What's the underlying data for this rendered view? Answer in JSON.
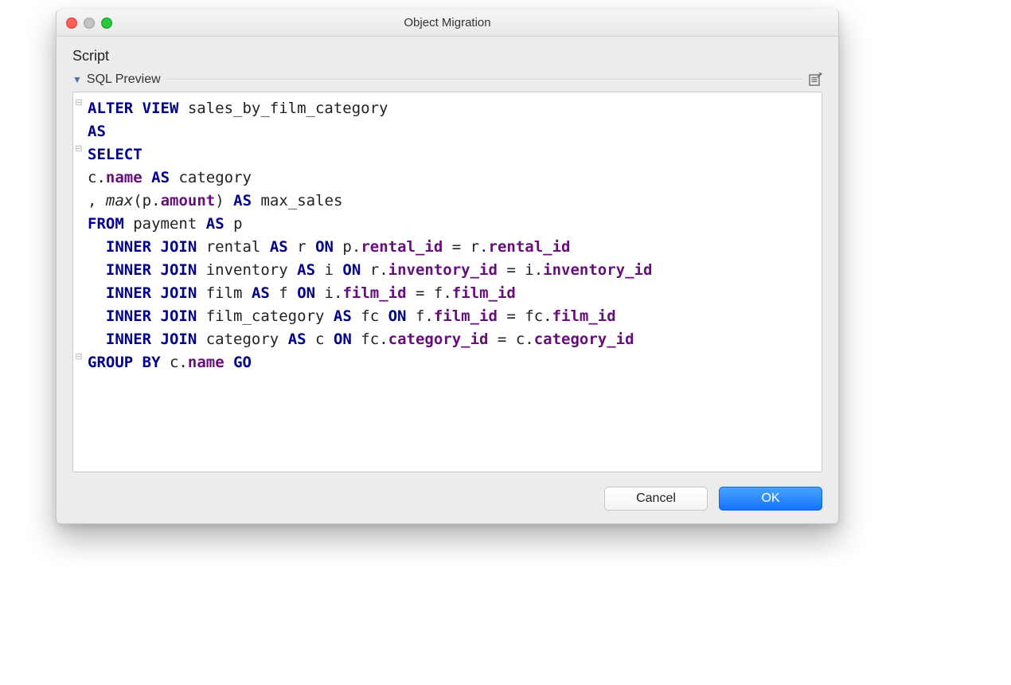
{
  "window": {
    "title": "Object Migration"
  },
  "section": {
    "label": "Script",
    "disclosure": "SQL Preview"
  },
  "code": {
    "l1": {
      "kw_alter_view": "ALTER VIEW",
      "view_name": "sales_by_film_category"
    },
    "l2": {
      "kw_as": "AS"
    },
    "l3": {
      "kw_select": "SELECT"
    },
    "l4": {
      "alias_c": "c",
      "dot": ".",
      "col_name": "name",
      "kw_as": "AS",
      "as_alias": "category"
    },
    "l5": {
      "comma": ", ",
      "fn_max": "max",
      "lp": "(",
      "alias_p": "p",
      "dot": ".",
      "col_amount": "amount",
      "rp": ")",
      "kw_as": "AS",
      "as_alias": "max_sales"
    },
    "l6": {
      "kw_from": "FROM",
      "tbl": "payment",
      "kw_as": "AS",
      "alias": "p"
    },
    "l7": {
      "kw_inner_join": "INNER JOIN",
      "tbl": "rental",
      "kw_as": "AS",
      "alias": "r",
      "kw_on": "ON",
      "la": "p",
      "dot": ".",
      "lc": "rental_id",
      "eq": " = ",
      "ra": "r",
      "rc": "rental_id"
    },
    "l8": {
      "kw_inner_join": "INNER JOIN",
      "tbl": "inventory",
      "kw_as": "AS",
      "alias": "i",
      "kw_on": "ON",
      "la": "r",
      "dot": ".",
      "lc": "inventory_id",
      "eq": " = ",
      "ra": "i",
      "rc": "inventory_id"
    },
    "l9": {
      "kw_inner_join": "INNER JOIN",
      "tbl": "film",
      "kw_as": "AS",
      "alias": "f",
      "kw_on": "ON",
      "la": "i",
      "dot": ".",
      "lc": "film_id",
      "eq": " = ",
      "ra": "f",
      "rc": "film_id"
    },
    "l10": {
      "kw_inner_join": "INNER JOIN",
      "tbl": "film_category",
      "kw_as": "AS",
      "alias": "fc",
      "kw_on": "ON",
      "la": "f",
      "dot": ".",
      "lc": "film_id",
      "eq": " = ",
      "ra": "fc",
      "rc": "film_id"
    },
    "l11": {
      "kw_inner_join": "INNER JOIN",
      "tbl": "category",
      "kw_as": "AS",
      "alias": "c",
      "kw_on": "ON",
      "la": "fc",
      "dot": ".",
      "lc": "category_id",
      "eq": " = ",
      "ra": "c",
      "rc": "category_id"
    },
    "l12": {
      "kw_group_by": "GROUP BY",
      "alias": "c",
      "dot": ".",
      "col": "name",
      "kw_go": "GO"
    }
  },
  "buttons": {
    "cancel": "Cancel",
    "ok": "OK"
  }
}
